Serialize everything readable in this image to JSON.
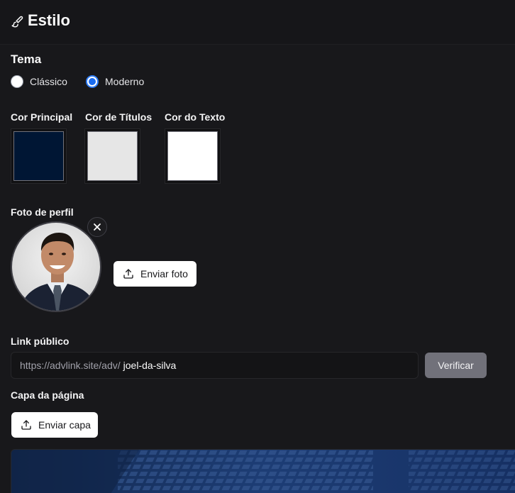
{
  "header": {
    "icon": "paintbrush-icon",
    "title": "Estilo"
  },
  "theme": {
    "title": "Tema",
    "options": [
      {
        "label": "Clássico",
        "selected": false
      },
      {
        "label": "Moderno",
        "selected": true
      }
    ]
  },
  "colors": {
    "items": [
      {
        "label": "Cor Principal",
        "value": "#001634"
      },
      {
        "label": "Cor de Títulos",
        "value": "#e6e6e6"
      },
      {
        "label": "Cor do Texto",
        "value": "#ffffff"
      }
    ]
  },
  "profile_photo": {
    "label": "Foto de perfil",
    "remove_icon": "close-icon",
    "upload_label": "Enviar foto",
    "upload_icon": "upload-icon"
  },
  "public_link": {
    "label": "Link público",
    "prefix": "https://advlink.site/adv/",
    "value": "joel-da-silva",
    "verify_label": "Verificar"
  },
  "cover": {
    "label": "Capa da página",
    "upload_label": "Enviar capa",
    "upload_icon": "upload-icon"
  }
}
